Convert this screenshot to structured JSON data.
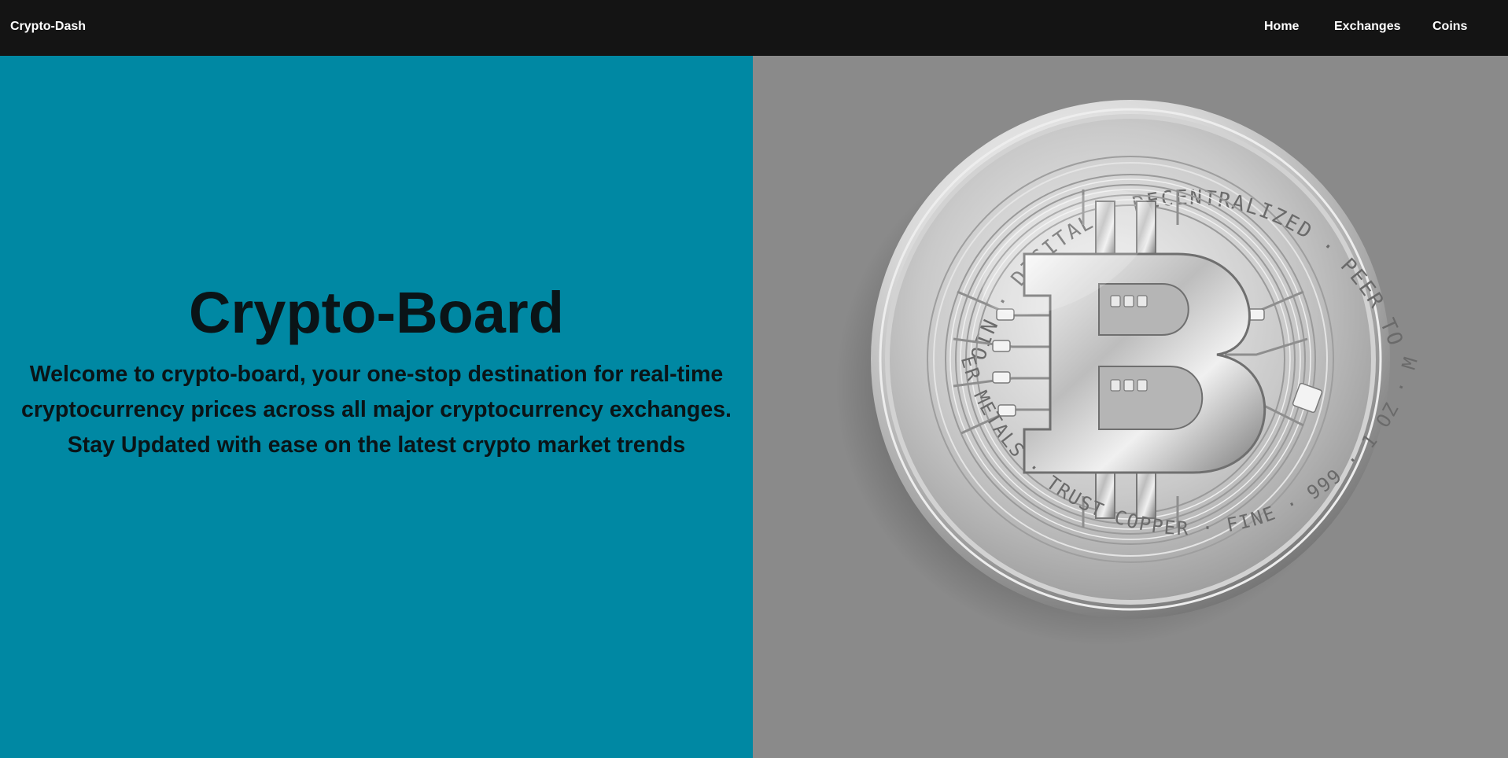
{
  "navbar": {
    "brand": "Crypto-Dash",
    "links": [
      "Home",
      "Exchanges",
      "Coins"
    ]
  },
  "hero": {
    "title": "Crypto-Board",
    "lines": [
      "Welcome to crypto-board, your one-stop destination for real-time",
      "cryptocurrency prices across all major cryptocurrency exchanges.",
      "Stay Updated with ease on the latest crypto market trends"
    ],
    "coin_image": {
      "icon": "bitcoin-coin-icon",
      "inscription_top": "BITCOIN · DIGITAL · DECENTRALIZED · PEER TO PEER",
      "inscription_bottom": "SILVER METALS · TRUST COPPER · FINE · 999 · 1 OZ · MMXII"
    }
  },
  "colors": {
    "navbar_bg": "#141414",
    "hero_left_bg": "#0088a3",
    "hero_right_bg": "#8a8a8a",
    "text_dark": "#0a1417"
  }
}
